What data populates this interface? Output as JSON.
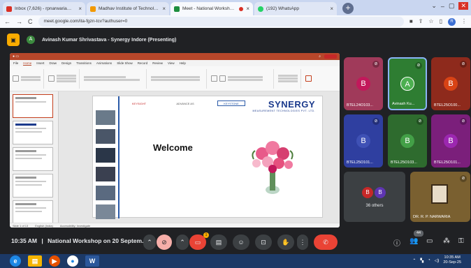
{
  "browser": {
    "tabs": [
      {
        "title": "Inbox (7,626) - rpnarwaria@mits",
        "favicon_color": "#d93025",
        "active": false
      },
      {
        "title": "Madhav Institute of Technology",
        "favicon_color": "#f29900",
        "active": false
      },
      {
        "title": "Meet - National Workshop o",
        "favicon_color": "#1e8e3e",
        "active": true
      },
      {
        "title": "(192) WhatsApp",
        "favicon_color": "#25d366",
        "active": false
      }
    ],
    "close_glyph": "×",
    "new_tab_glyph": "+",
    "url": "meet.google.com/ita-fgzn-tcv?authuser=0",
    "profile_initial": "R"
  },
  "meet": {
    "presenter_initial": "A",
    "presenter_text": "Avinash Kumar Shrivastava - Synergy Indore (Presenting)",
    "participants": [
      {
        "name": "BTEL24O103...",
        "initial": "B",
        "bg": "#a03a5a",
        "av": "#c2185b"
      },
      {
        "name": "Avinash Ku...",
        "initial": "A",
        "bg": "#2e7d32",
        "av": "#4caf50",
        "speaking": true
      },
      {
        "name": "BTEL25O100...",
        "initial": "B",
        "bg": "#8e2a1c",
        "av": "#d84315"
      },
      {
        "name": "BTEL25O101...",
        "initial": "B",
        "bg": "#2f3fa0",
        "av": "#3f51b5"
      },
      {
        "name": "BTEL25O103...",
        "initial": "B",
        "bg": "#2e6b2e",
        "av": "#43a047"
      },
      {
        "name": "BTEL25O101...",
        "initial": "B",
        "bg": "#7b1f7b",
        "av": "#9c27b0"
      }
    ],
    "others_label": "36 others",
    "others_initials": [
      "B",
      "B"
    ],
    "rp_name": "DR. R. P. NARWARIA",
    "time": "10:35 AM",
    "separator": "|",
    "meeting_title": "National Workshop on 20 Septem...",
    "people_count": "44",
    "reaction_badge": "1"
  },
  "ppt": {
    "tabs": [
      "File",
      "Home",
      "Insert",
      "Draw",
      "Design",
      "Transitions",
      "Animations",
      "Slide Show",
      "Record",
      "Review",
      "View",
      "Help"
    ],
    "active_tab": "Home",
    "slide_logo_1": "KEYSIGHT",
    "slide_logo_2": "ADVANCE AS",
    "slide_logo_3": "KEYSTONE",
    "synergy_big": "SYNERGY",
    "synergy_small": "MEASUREMENT TECHNOLOGIES PVT. LTD.",
    "welcome": "Welcome",
    "status_left": "Slide 1 of 13",
    "status_mid": "English (India)",
    "status_acc": "Accessibility: Investigate"
  },
  "taskbar": {
    "time": "10:35 AM",
    "date": "20-Sep-25"
  }
}
